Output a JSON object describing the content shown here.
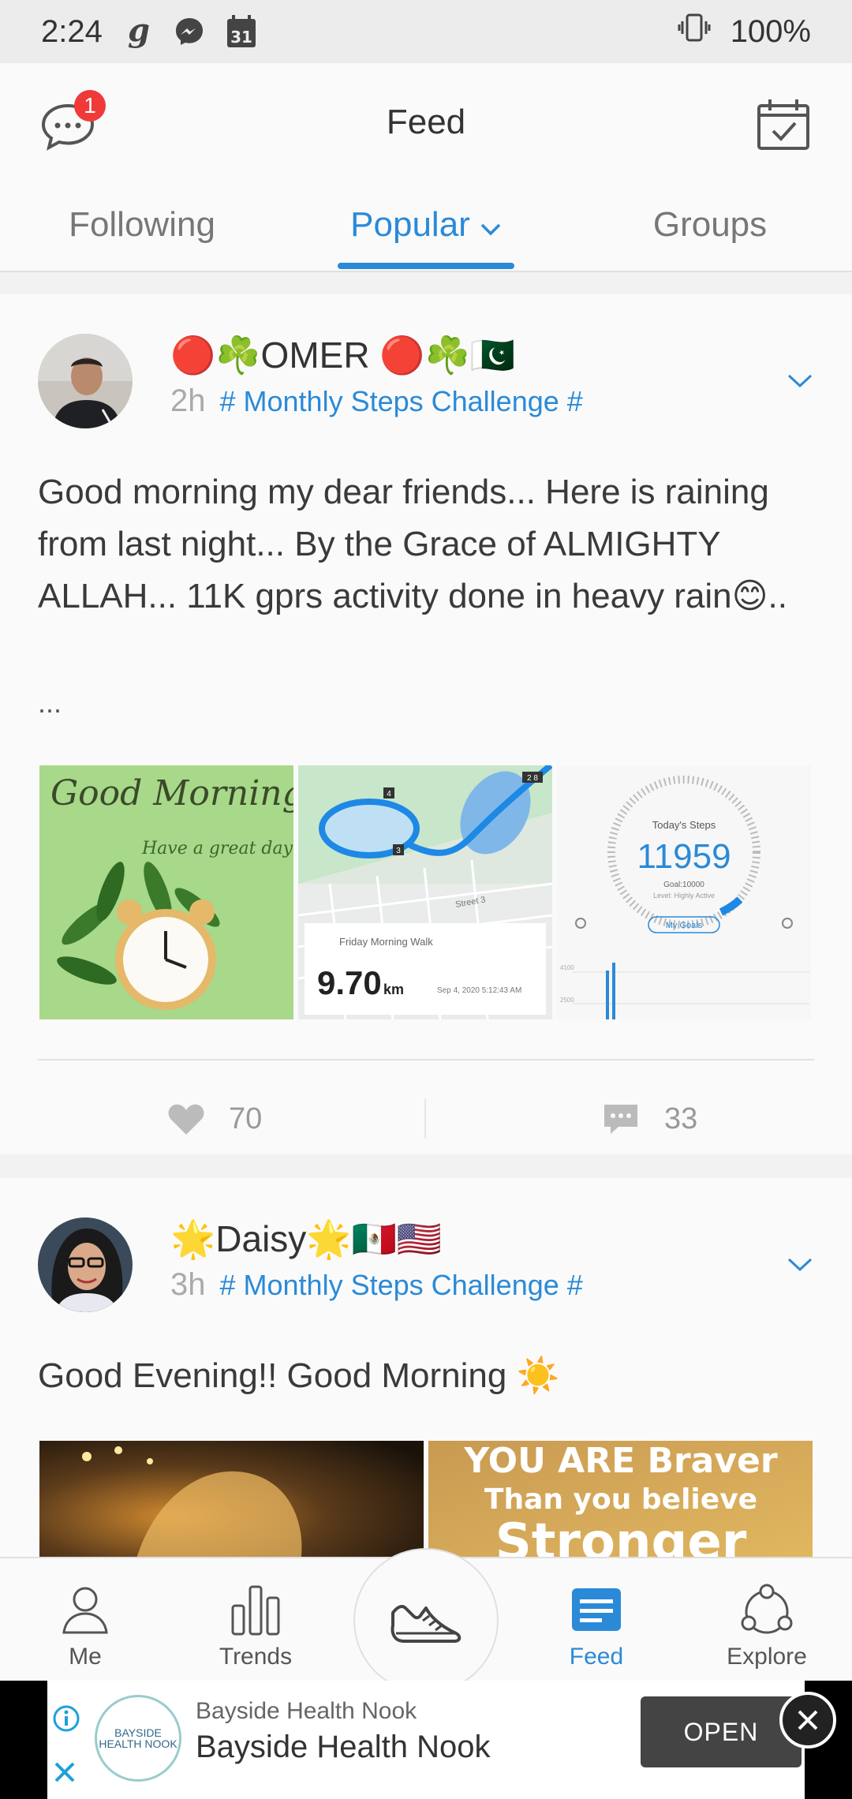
{
  "status_bar": {
    "time": "2:24",
    "icons": [
      "g-icon",
      "messenger-icon",
      "calendar-31-icon"
    ],
    "calendar_day": "31",
    "battery": "100%"
  },
  "header": {
    "title": "Feed",
    "message_badge": "1"
  },
  "tabs": [
    {
      "label": "Following",
      "active": false
    },
    {
      "label": "Popular",
      "active": true
    },
    {
      "label": "Groups",
      "active": false
    }
  ],
  "posts": [
    {
      "user": "🔴☘️OMER 🔴☘️🇵🇰",
      "time_ago": "2h",
      "tag": "# Monthly Steps Challenge #",
      "text": "Good morning my dear friends... Here is raining from last night... By the Grace of ALMIGHTY ALLAH... 11K gprs activity done in heavy rain😊..",
      "more": "...",
      "images": {
        "good_morning": {
          "title": "Good Morning",
          "subtitle": "Have a great day"
        },
        "map": {
          "activity": "Friday Morning Walk",
          "distance": "9.70",
          "unit": "km",
          "date": "Sep 4, 2020 5:12:43 AM",
          "street": "Street 3",
          "markers": [
            "4",
            "3",
            "2 8"
          ]
        },
        "steps": {
          "label": "Today's Steps",
          "value": "11959",
          "goal": "Goal:10000",
          "level": "Level: Highly Active",
          "button": "My Goals",
          "axis_top": "4100",
          "axis_bottom": "2500"
        }
      },
      "likes": "70",
      "comments": "33"
    },
    {
      "user": "🌟Daisy🌟🇲🇽🇺🇸",
      "time_ago": "3h",
      "tag": "# Monthly Steps Challenge #",
      "text": "Good Evening!! Good Morning ☀️",
      "images": {
        "right_text_1": "YOU ARE Braver",
        "right_text_2": "Than you believe",
        "right_text_3": "Stronger"
      }
    }
  ],
  "bottom_nav": [
    {
      "label": "Me",
      "icon": "person-icon",
      "active": false
    },
    {
      "label": "Trends",
      "icon": "bar-chart-icon",
      "active": false
    },
    {
      "label": "",
      "icon": "sneaker-icon",
      "active": false
    },
    {
      "label": "Feed",
      "icon": "feed-icon",
      "active": true
    },
    {
      "label": "Explore",
      "icon": "explore-icon",
      "active": false
    }
  ],
  "ad": {
    "logo_text": "BAYSIDE HEALTH NOOK",
    "advertiser": "Bayside Health Nook",
    "headline": "Bayside Health Nook",
    "cta": "OPEN"
  },
  "colors": {
    "accent": "#2a8ad8",
    "badge": "#f03a3a"
  }
}
